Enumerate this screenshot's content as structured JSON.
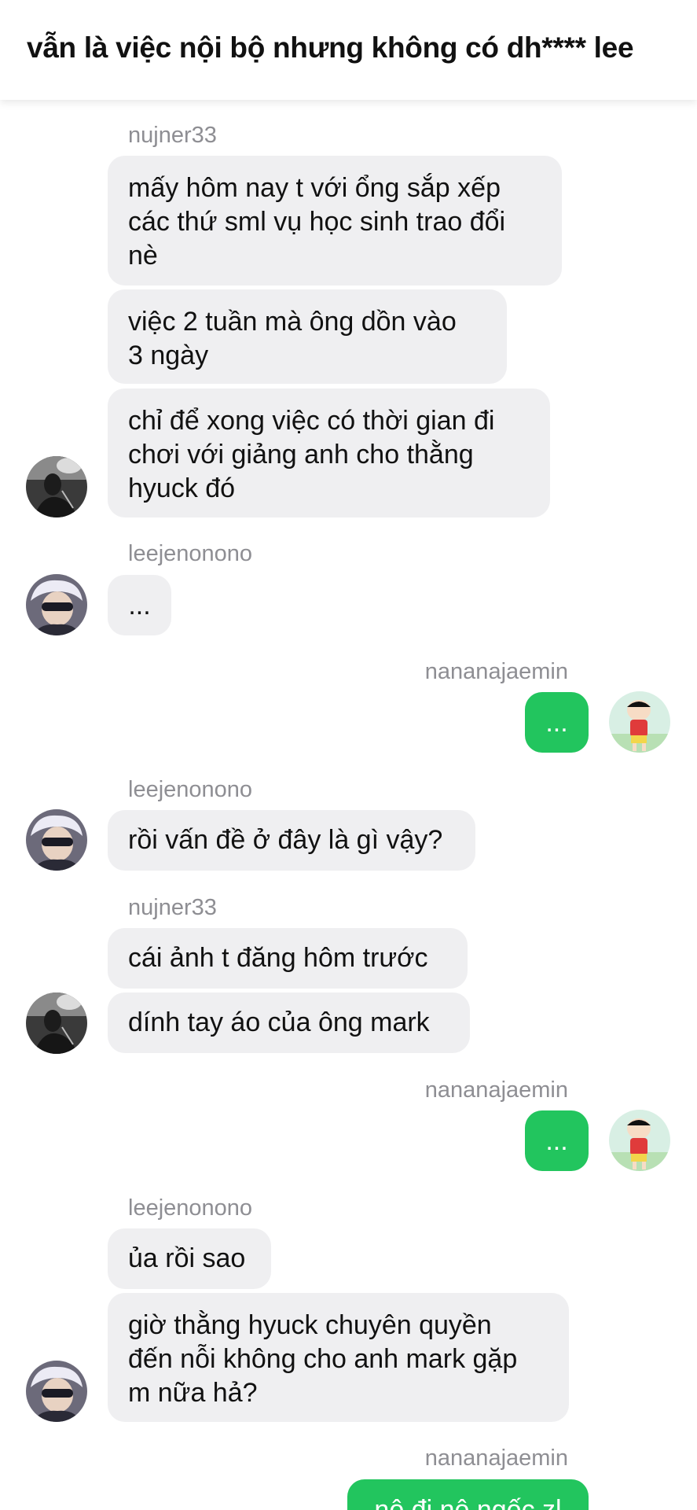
{
  "header": {
    "title": "vẫn là việc nội bộ nhưng không có dh**** lee"
  },
  "messages": [
    {
      "sender": "nujner33",
      "bubbles": [
        "mấy hôm nay t với ổng sắp xếp\ncác thứ sml vụ học sinh trao đổi\nnè",
        "việc 2 tuần mà ông dồn vào\n3 ngày",
        "chỉ để xong việc có thời gian đi\nchơi với giảng anh cho thằng\nhyuck đó"
      ]
    },
    {
      "sender": "leejenonono",
      "bubbles": [
        "..."
      ]
    },
    {
      "sender": "nananajaemin",
      "bubbles": [
        "..."
      ]
    },
    {
      "sender": "leejenonono",
      "bubbles": [
        "rồi vấn đề ở đây là gì vậy?"
      ]
    },
    {
      "sender": "nujner33",
      "bubbles": [
        "cái ảnh t đăng hôm trước",
        "dính tay áo của ông mark"
      ]
    },
    {
      "sender": "nananajaemin",
      "bubbles": [
        "..."
      ]
    },
    {
      "sender": "leejenonono",
      "bubbles": [
        "ủa rồi sao",
        "giờ thằng hyuck chuyên quyền\nđến nỗi không cho anh mark gặp\nm nữa hả?"
      ]
    },
    {
      "sender": "nananajaemin",
      "bubbles": [
        "nô đi nô ngốc zl"
      ]
    }
  ],
  "colors": {
    "outgoing_bubble": "#22c55e",
    "incoming_bubble": "#efeff1",
    "sender_name": "#8e8e93"
  },
  "avatars": {
    "nujner33": "grayscale-portrait-avatar",
    "leejenonono": "white-haired-sunglasses-avatar",
    "nananajaemin": "cartoon-boy-avatar"
  }
}
